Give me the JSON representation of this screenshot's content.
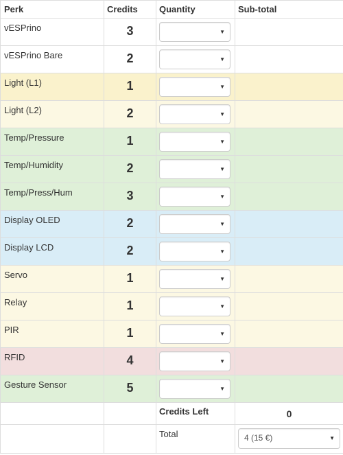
{
  "headers": {
    "perk": "Perk",
    "credits": "Credits",
    "quantity": "Quantity",
    "subtotal": "Sub-total"
  },
  "rows": [
    {
      "name": "vESPrino",
      "credits": "3",
      "color": "#ffffff"
    },
    {
      "name": "vESPrino Bare",
      "credits": "2",
      "color": "#ffffff"
    },
    {
      "name": "Light (L1)",
      "credits": "1",
      "color": "#faf2cc"
    },
    {
      "name": "Light (L2)",
      "credits": "2",
      "color": "#fcf8e3"
    },
    {
      "name": "Temp/Pressure",
      "credits": "1",
      "color": "#dff0d8"
    },
    {
      "name": "Temp/Humidity",
      "credits": "2",
      "color": "#dff0d8"
    },
    {
      "name": "Temp/Press/Hum",
      "credits": "3",
      "color": "#dff0d8"
    },
    {
      "name": "Display OLED",
      "credits": "2",
      "color": "#d9edf7"
    },
    {
      "name": "Display LCD",
      "credits": "2",
      "color": "#d9edf7"
    },
    {
      "name": "Servo",
      "credits": "1",
      "color": "#fcf8e3"
    },
    {
      "name": "Relay",
      "credits": "1",
      "color": "#fcf8e3"
    },
    {
      "name": "PIR",
      "credits": "1",
      "color": "#fcf8e3"
    },
    {
      "name": "RFID",
      "credits": "4",
      "color": "#f2dede"
    },
    {
      "name": "Gesture Sensor",
      "credits": "5",
      "color": "#dff0d8"
    }
  ],
  "summary": {
    "credits_left_label": "Credits Left",
    "credits_left_value": "0",
    "total_label": "Total",
    "total_selected": "4 (15 €)"
  },
  "icons": {
    "dropdown": "caret-down-icon"
  }
}
